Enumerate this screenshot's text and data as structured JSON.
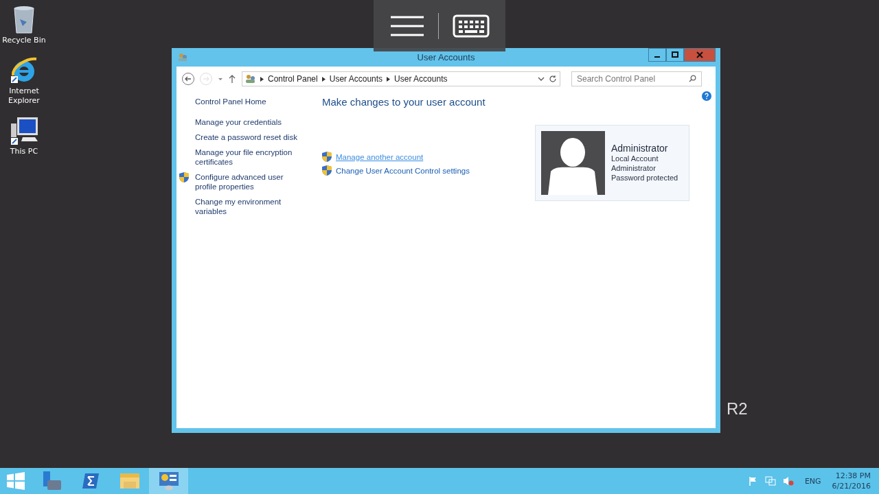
{
  "desktop_icons": [
    {
      "label": "Recycle Bin",
      "kind": "bin"
    },
    {
      "label": "Internet Explorer",
      "kind": "ie"
    },
    {
      "label": "This PC",
      "kind": "pc"
    }
  ],
  "desktop_text": "R2",
  "window": {
    "title": "User Accounts",
    "address": {
      "crumbs": [
        "Control Panel",
        "User Accounts",
        "User Accounts"
      ]
    },
    "search": {
      "placeholder": "Search Control Panel"
    },
    "sidebar": {
      "home": "Control Panel Home",
      "links": [
        {
          "label": "Manage your credentials",
          "shield": false
        },
        {
          "label": "Create a password reset disk",
          "shield": false
        },
        {
          "label": "Manage your file encryption certificates",
          "shield": false
        },
        {
          "label": "Configure advanced user profile properties",
          "shield": true
        },
        {
          "label": "Change my environment variables",
          "shield": false
        }
      ]
    },
    "heading": "Make changes to your user account",
    "tasks": [
      {
        "label": "Manage another account",
        "hovered": true
      },
      {
        "label": "Change User Account Control settings",
        "hovered": false
      }
    ],
    "account": {
      "name": "Administrator",
      "details": [
        "Local Account",
        "Administrator",
        "Password protected"
      ]
    }
  },
  "taskbar": {
    "apps": [
      {
        "kind": "server",
        "selected": false
      },
      {
        "kind": "shell",
        "selected": false
      },
      {
        "kind": "folder",
        "selected": false
      },
      {
        "kind": "panel",
        "selected": true
      }
    ],
    "language": "ENG",
    "time": "12:38 PM",
    "date": "6/21/2016"
  }
}
